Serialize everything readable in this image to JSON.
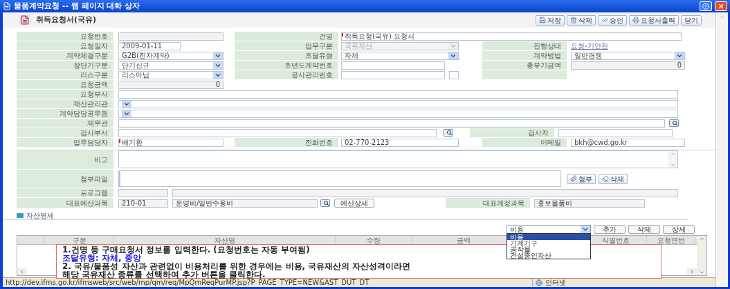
{
  "window": {
    "title": "물품계약요청 -- 웹 페이지 대화 상자"
  },
  "header": {
    "title": "취득요청서(국유)",
    "buttons": [
      {
        "kind": "save",
        "label": "저장"
      },
      {
        "kind": "delete",
        "label": "삭제"
      },
      {
        "kind": "approve",
        "label": "승인"
      },
      {
        "kind": "print",
        "label": "요청서출력"
      },
      {
        "kind": "plain",
        "label": "닫기"
      }
    ]
  },
  "form": {
    "request_no": {
      "label": "요청번호"
    },
    "subject": {
      "label": "건명",
      "value": "취득요청(국유) 요청서",
      "required": true
    },
    "request_date": {
      "label": "요청일자",
      "value": "2009-01-11"
    },
    "business_type": {
      "label": "업무구분",
      "value": "국유재산",
      "disabled": true
    },
    "status": {
      "label": "진행상태",
      "value": "요청-기안전"
    },
    "contract_type": {
      "label": "계약체결구분",
      "value": "G2B(전자계약)"
    },
    "procurement_type": {
      "label": "조달유형",
      "value": "자체"
    },
    "contract_method": {
      "label": "계약방법",
      "value": "일반경쟁"
    },
    "term_type": {
      "label": "장단기구분",
      "value": "단기신규"
    },
    "first_year_contract_no": {
      "label": "초년도계약번호"
    },
    "total_amount": {
      "label": "총부기금액",
      "value": "0"
    },
    "lease_type": {
      "label": "리스구분",
      "value": "리스아님"
    },
    "construction_no": {
      "label": "공사관리번호"
    },
    "request_amount": {
      "label": "요청금액",
      "value": "0"
    },
    "request_dept": {
      "label": "요청부서"
    },
    "property_manager": {
      "label": "재산관리관"
    },
    "contract_officer": {
      "label": "계약담당공무원"
    },
    "finance_officer": {
      "label": "재무관"
    },
    "inspection_dept": {
      "label": "검사부서"
    },
    "inspector": {
      "label": "검사자"
    },
    "staff": {
      "label": "업무담당자",
      "value": "배기환",
      "required": true
    },
    "phone": {
      "label": "전화번호",
      "value": "02-770-2123"
    },
    "email": {
      "label": "이메일",
      "value": "bkh@cwd.go.kr"
    },
    "remarks": {
      "label": "비고"
    },
    "attachment": {
      "label": "첨부파일",
      "buttons": [
        {
          "kind": "attach",
          "label": "첨부"
        },
        {
          "kind": "remove",
          "label": "삭제"
        }
      ]
    },
    "program": {
      "label": "프로그램"
    },
    "budget": {
      "label": "대표예산과목",
      "code": "210-01",
      "name": "운영비/일반수용비",
      "button": "예산상세"
    },
    "account": {
      "label": "대표계정과목",
      "value": "홍보물품비"
    }
  },
  "assets": {
    "title": "자산명세",
    "type_select": {
      "value": "비용",
      "expanded": true,
      "options": [
        {
          "label": "비용",
          "selected": true
        },
        {
          "label": "기계기구",
          "selected": false
        },
        {
          "label": "공작물",
          "selected": false
        },
        {
          "label": "건설중인자산",
          "selected": false
        }
      ]
    },
    "buttons": [
      "추가",
      "삭제",
      "상세"
    ],
    "columns": [
      "구분",
      "자산명",
      "수량",
      "금액",
      "식별번호",
      "요청연번"
    ]
  },
  "callout": {
    "lines": [
      {
        "kind": "plain",
        "text": "1.건명 등 구매요청서 정보를 입력한다. (요청번호는 자동 부여됨)"
      },
      {
        "kind": "highlight",
        "text": "조달유형: 자체, 중앙"
      },
      {
        "kind": "plain",
        "text": "2. 국유/물품성 자산과 관련없이 비용처리를 위한 경우에는 비용, 국유재산의 자산성격이라면"
      },
      {
        "kind": "plain",
        "text": "해당 국유재산 종류를 선택하여 추가 버튼을 클릭한다."
      }
    ]
  },
  "status_bar": {
    "url": "http://dev.ifms.go.kr/ifmsweb/src/web/mp/qm/req/MpQmReqPurMP.jsp?P_PAGE_TYPE=NEW&AST_DUT_DT",
    "zone": "인터넷"
  }
}
